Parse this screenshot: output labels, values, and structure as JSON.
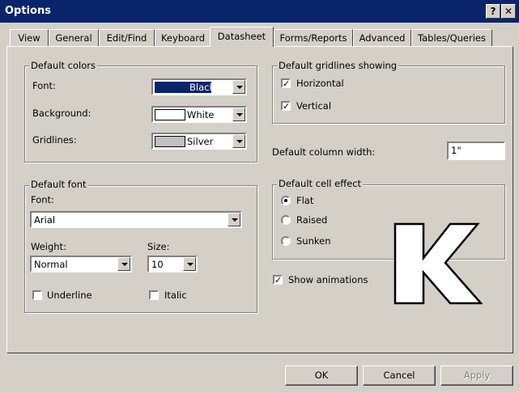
{
  "window": {
    "title": "Options",
    "help_label": "?",
    "close_label": "✕"
  },
  "tabs": [
    "View",
    "General",
    "Edit/Find",
    "Keyboard",
    "Datasheet",
    "Forms/Reports",
    "Advanced",
    "Tables/Queries"
  ],
  "active_tab": "Datasheet",
  "default_colors": {
    "title": "Default colors",
    "font_label": "Font:",
    "font_value": "Black",
    "background_label": "Background:",
    "background_value": "White",
    "gridlines_label": "Gridlines:",
    "gridlines_value": "Silver"
  },
  "gridlines": {
    "title": "Default gridlines showing",
    "horizontal_label": "Horizontal",
    "horizontal_checked": true,
    "vertical_label": "Vertical",
    "vertical_checked": true
  },
  "column_width": {
    "label": "Default column width:",
    "value": "1\""
  },
  "default_font": {
    "title": "Default font",
    "font_label": "Font:",
    "font_value": "Arial",
    "weight_label": "Weight:",
    "weight_value": "Normal",
    "size_label": "Size:",
    "size_value": "10",
    "underline_label": "Underline",
    "italic_label": "Italic"
  },
  "cell_effect": {
    "title": "Default cell effect",
    "options": [
      "Flat",
      "Raised",
      "Sunken"
    ],
    "selected": "Flat"
  },
  "show_animations": {
    "label": "Show animations",
    "checked": true
  },
  "watermark_letter": "K",
  "buttons": {
    "ok": "OK",
    "cancel": "Cancel",
    "apply": "Apply"
  },
  "colors": {
    "title_bar": "#0a246a",
    "face": "#d4d0c8",
    "black_swatch": "#000000",
    "silver_swatch": "#c0c0c0"
  }
}
